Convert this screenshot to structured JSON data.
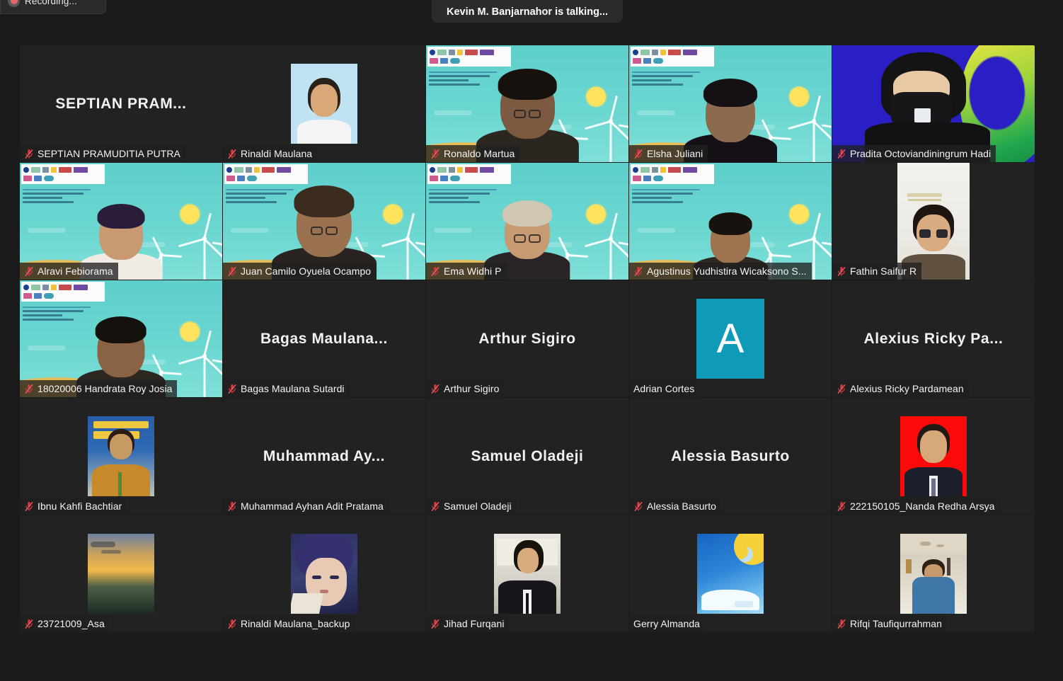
{
  "window": {
    "app": "Zoom Meeting",
    "background_color": "#1b1b1b"
  },
  "recording_indicator": {
    "label": "Recording...",
    "icon": "record-dot-icon"
  },
  "talking_indicator": {
    "label": "Kevin M. Banjarnahor is talking...",
    "speaker": "Kevin M. Banjarnahor"
  },
  "gallery": {
    "columns": 5,
    "rows": 5,
    "mute_icon": "microphone-muted-icon",
    "mute_icon_color": "#e0434a",
    "participants": [
      {
        "name": "SEPTIAN PRAMUDITIA PUTRA",
        "display": "SEPTIAN  PRAM...",
        "type": "name-only",
        "muted": true
      },
      {
        "name": "Rinaldi Maulana",
        "display": "",
        "type": "avatar-photo",
        "avatar": "portrait-blue-backdrop",
        "muted": true
      },
      {
        "name": "Ronaldo Martua",
        "display": "",
        "type": "video",
        "background": "virtual-wind-farm",
        "muted": true
      },
      {
        "name": "Elsha Juliani",
        "display": "",
        "type": "video",
        "background": "virtual-wind-farm",
        "muted": true
      },
      {
        "name": "Pradita Octoviandiningrum Hadi",
        "display": "",
        "type": "video",
        "background": "blue-green-swirl",
        "muted": true
      },
      {
        "name": "Alravi Febiorama",
        "display": "",
        "type": "video",
        "background": "virtual-wind-farm",
        "muted": true
      },
      {
        "name": "Juan Camilo Oyuela Ocampo",
        "display": "",
        "type": "video",
        "background": "virtual-wind-farm",
        "muted": true
      },
      {
        "name": "Ema Widhi P",
        "display": "",
        "type": "video",
        "background": "virtual-wind-farm",
        "muted": true
      },
      {
        "name": "Agustinus Yudhistira Wicaksono S...",
        "display": "",
        "type": "video",
        "background": "virtual-wind-farm",
        "muted": true
      },
      {
        "name": "Fathin Saifur R",
        "display": "",
        "type": "video-portrait",
        "background": "white-room",
        "muted": true
      },
      {
        "name": "18020006 Handrata Roy Josia",
        "display": "",
        "type": "video",
        "background": "virtual-wind-farm",
        "muted": true
      },
      {
        "name": "Bagas Maulana Sutardi",
        "display": "Bagas  Maulana...",
        "type": "name-only",
        "muted": true
      },
      {
        "name": "Arthur Sigiro",
        "display": "Arthur Sigiro",
        "type": "name-only",
        "muted": true
      },
      {
        "name": "Adrian Cortes",
        "display": "A",
        "type": "avatar-initial",
        "avatar_color": "#0f9bb7",
        "muted": false
      },
      {
        "name": "Alexius Ricky Pardamean",
        "display": "Alexius  Ricky  Pa...",
        "type": "name-only",
        "muted": true
      },
      {
        "name": "Ibnu Kahfi Bachtiar",
        "display": "",
        "type": "avatar-photo",
        "avatar": "batik-banner-portrait",
        "muted": true
      },
      {
        "name": "Muhammad Ayhan Adit Pratama",
        "display": "Muhammad  Ay...",
        "type": "name-only",
        "muted": true
      },
      {
        "name": "Samuel Oladeji",
        "display": "Samuel Oladeji",
        "type": "name-only",
        "muted": true
      },
      {
        "name": "Alessia Basurto",
        "display": "Alessia Basurto",
        "type": "name-only",
        "muted": true
      },
      {
        "name": "222150105_Nanda Redha Arsya",
        "display": "",
        "type": "avatar-photo",
        "avatar": "red-backdrop-id-photo",
        "muted": true
      },
      {
        "name": "23721009_Asa",
        "display": "",
        "type": "avatar-photo",
        "avatar": "sunset-landscape",
        "muted": true
      },
      {
        "name": "Rinaldi Maulana_backup",
        "display": "",
        "type": "avatar-photo",
        "avatar": "anime-character",
        "muted": true
      },
      {
        "name": "Jihad Furqani",
        "display": "",
        "type": "avatar-photo",
        "avatar": "conference-suit-portrait",
        "muted": true
      },
      {
        "name": "Gerry Almanda",
        "display": "",
        "type": "avatar-photo",
        "avatar": "blue-sky-sun-cloud",
        "muted": false
      },
      {
        "name": "Rifqi Taufiqurrahman",
        "display": "",
        "type": "avatar-photo",
        "avatar": "indoor-hall-portrait",
        "muted": true
      }
    ]
  }
}
